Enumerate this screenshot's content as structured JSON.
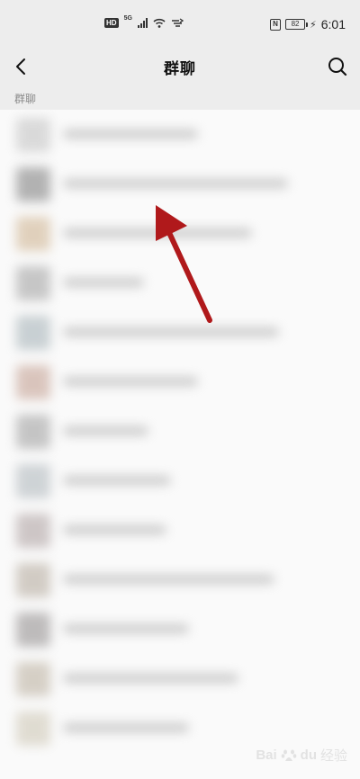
{
  "status_bar": {
    "left_badge": "HD",
    "network": "5G",
    "nfc": "N",
    "battery": "82",
    "time": "6:01"
  },
  "header": {
    "title": "群聊"
  },
  "section": {
    "label": "群聊"
  },
  "list": {
    "items": [
      {
        "avatar_color": "#cfcfcf"
      },
      {
        "avatar_color": "#9a9a9a"
      },
      {
        "avatar_color": "#d8c3a8"
      },
      {
        "avatar_color": "#b5b5b5"
      },
      {
        "avatar_color": "#b8c2c6"
      },
      {
        "avatar_color": "#cfb3a8"
      },
      {
        "avatar_color": "#b3b3b3"
      },
      {
        "avatar_color": "#c0c6ca"
      },
      {
        "avatar_color": "#bfb5b5"
      },
      {
        "avatar_color": "#c4bcb2"
      },
      {
        "avatar_color": "#a9a6a6"
      },
      {
        "avatar_color": "#c9c1b4"
      },
      {
        "avatar_color": "#d7d2c4"
      }
    ]
  },
  "annotation": {
    "arrow_color": "#b0191b"
  },
  "watermark": {
    "latin": "Bai",
    "rest": "du",
    "cn": "经验"
  }
}
